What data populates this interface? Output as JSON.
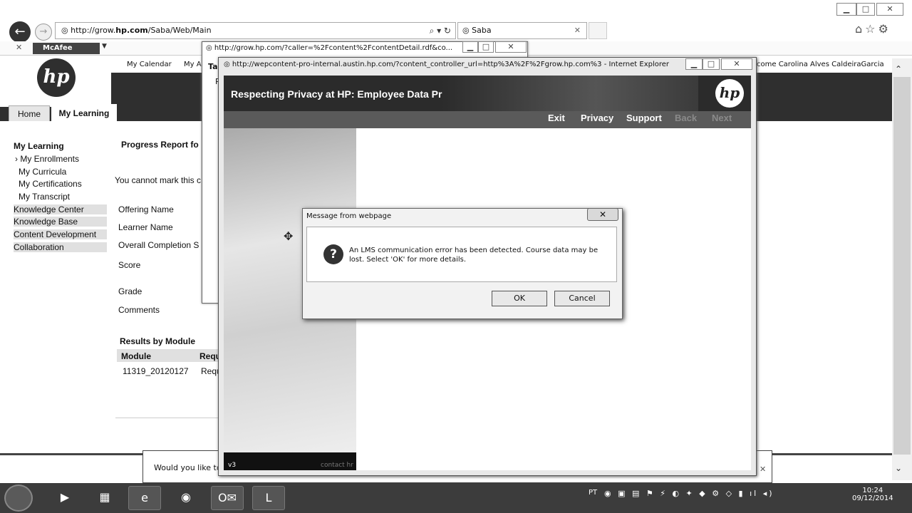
{
  "browser": {
    "url_prefix": "http://grow.",
    "url_domain": "hp.com",
    "url_path": "/Saba/Web/Main",
    "addr_tools": "⌕ ▾ ↻",
    "tab_title": "Saba",
    "toolbar_addon": "McAfee"
  },
  "site": {
    "logo": "hp",
    "menu": [
      "My Calendar",
      "My Ac"
    ],
    "welcome": "come  Carolina Alves CaldeiraGarcia",
    "tabs": [
      "Home",
      "My Learning"
    ]
  },
  "sidebar": {
    "heading": "My Learning",
    "items": [
      "› My Enrollments",
      "My Curricula",
      "My Certifications",
      "My Transcript",
      "Knowledge Center",
      "Knowledge Base",
      "Content Development",
      "Collaboration"
    ]
  },
  "main": {
    "title": "Progress Report fo",
    "notice": "You cannot mark this c",
    "fields": [
      "Offering Name",
      "Learner Name",
      "Overall Completion S",
      "Score",
      "Grade",
      "Comments"
    ],
    "results_title": "Results by Module",
    "columns": [
      "Module",
      "Requ"
    ],
    "row": [
      "11319_20120127",
      "Requ"
    ]
  },
  "notification": "Would you like to",
  "popup1": {
    "url": "http://grow.hp.com/?caller=%2Fcontent%2FcontentDetail.rdf&co...",
    "tab_label": "Ta",
    "partial": "R"
  },
  "popup2": {
    "title": "http://wepcontent-pro-internal.austin.hp.com/?content_controller_url=http%3A%2F%2Fgrow.hp.com%3 - Internet Explorer",
    "course_title": "Respecting Privacy at HP: Employee Data Pr",
    "nav": [
      "Exit",
      "Privacy",
      "Support",
      "Back",
      "Next"
    ],
    "version": "v3",
    "footer_link": "contact hr"
  },
  "dialog": {
    "title": "Message from webpage",
    "message": "An LMS communication error has been detected. Course data may be lost. Select 'OK' for more details.",
    "ok": "OK",
    "cancel": "Cancel"
  },
  "taskbar": {
    "lang": "PT",
    "time": "10:24",
    "date": "09/12/2014"
  }
}
